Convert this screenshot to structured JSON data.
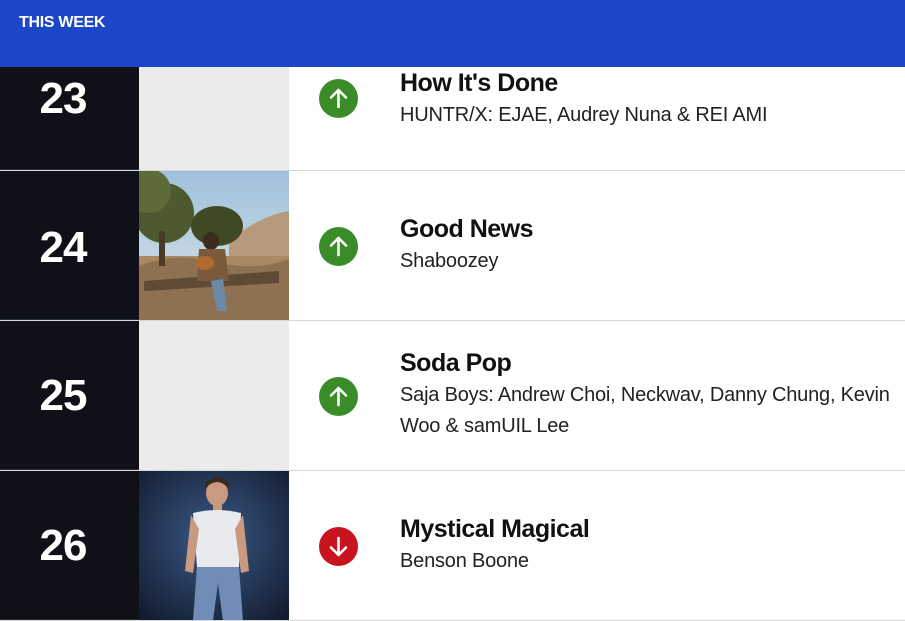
{
  "header": {
    "label": "THIS WEEK",
    "background": "#1b46c8"
  },
  "colors": {
    "rank_background": "#101118",
    "trend_up": "#3a8c28",
    "trend_down": "#c8141e"
  },
  "entries": [
    {
      "rank": "23",
      "title": "How It's Done",
      "artist": "HUNTR/X: EJAE, Audrey Nuna & REI AMI",
      "trend": "up",
      "trend_icon": "arrow-up-icon",
      "artwork": "none"
    },
    {
      "rank": "24",
      "title": "Good News",
      "artist": "Shaboozey",
      "trend": "up",
      "trend_icon": "arrow-up-icon",
      "artwork": "photo-man-with-guitar-outdoors"
    },
    {
      "rank": "25",
      "title": "Soda Pop",
      "artist": "Saja Boys: Andrew Choi, Neckwav, Danny Chung, Kevin Woo & samUIL Lee",
      "trend": "up",
      "trend_icon": "arrow-up-icon",
      "artwork": "none"
    },
    {
      "rank": "26",
      "title": "Mystical Magical",
      "artist": "Benson Boone",
      "trend": "down",
      "trend_icon": "arrow-down-icon",
      "artwork": "photo-man-in-white-shirt"
    }
  ]
}
